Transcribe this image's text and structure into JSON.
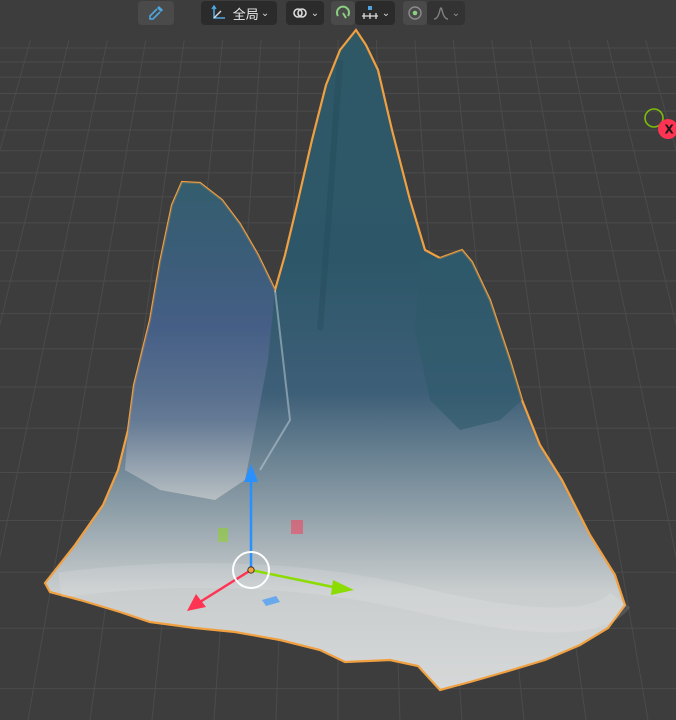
{
  "toolbar": {
    "eyedropper_icon": "eyedropper-icon",
    "transform_orientation_label": "全局",
    "pivot_icon": "link-pivot-icon",
    "snap_icon": "magnet-snap-icon",
    "snap_increment_icon": "snap-increment-icon",
    "proportional_icon": "proportional-edit-icon",
    "falloff_icon": "falloff-curve-icon"
  },
  "gizmo": {
    "x_axis_label": "X"
  },
  "colors": {
    "viewport_bg": "#3d3d3d",
    "grid_line": "#4a4a4a",
    "selection_outline": "#f0a040",
    "axis_x": "#ff3352",
    "axis_y": "#8bdc00",
    "axis_z": "#2890ff",
    "toolbar_accent": "#4fa7e0"
  }
}
